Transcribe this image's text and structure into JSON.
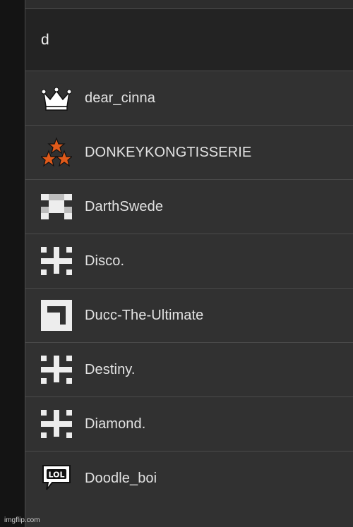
{
  "search": {
    "query": "d"
  },
  "results": [
    {
      "name": "dear_cinna",
      "icon": "crown-icon"
    },
    {
      "name": "DONKEYKONGTISSERIE",
      "icon": "stars-pyramid-icon"
    },
    {
      "name": "DarthSwede",
      "icon": "pixel-checker-icon"
    },
    {
      "name": "Disco.",
      "icon": "pixel-cross-icon"
    },
    {
      "name": "Ducc-The-Ultimate",
      "icon": "pixel-square-icon"
    },
    {
      "name": "Destiny.",
      "icon": "pixel-cross-icon"
    },
    {
      "name": "Diamond.",
      "icon": "pixel-cross-icon"
    },
    {
      "name": "Doodle_boi",
      "icon": "lol-speech-bubble-icon"
    }
  ],
  "colors": {
    "panel": "#313131",
    "search": "#232323",
    "star": "#e05a1a"
  },
  "watermark": "imgflip.com"
}
